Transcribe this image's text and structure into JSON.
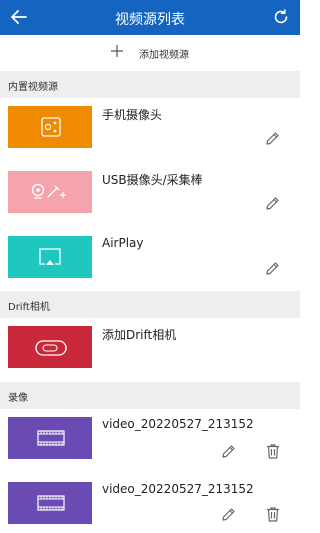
{
  "header": {
    "title": "视频源列表",
    "back_icon": "arrow-left-icon",
    "refresh_icon": "refresh-icon",
    "color": "#1565c0"
  },
  "add_source": {
    "label": "添加视频源",
    "icon": "plus-icon"
  },
  "sections": {
    "builtin": {
      "label": "内置视频源"
    },
    "drift": {
      "label": "Drift相机"
    },
    "recordings": {
      "label": "录像"
    }
  },
  "sources": [
    {
      "name": "手机摄像头",
      "color": "#f08a00",
      "icon": "phone-camera-icon"
    },
    {
      "name": "USB摄像头/采集棒",
      "color": "#f5a3ad",
      "icon": "usb-camera-icon"
    },
    {
      "name": "AirPlay",
      "color": "#1ec8bf",
      "icon": "airplay-icon"
    }
  ],
  "drift": [
    {
      "name": "添加Drift相机",
      "color": "#c8283a",
      "icon": "drift-camera-icon"
    }
  ],
  "recordings": [
    {
      "name": "video_20220527_213152",
      "color": "#6a4bb3",
      "icon": "film-icon"
    },
    {
      "name": "video_20220527_213152",
      "color": "#6a4bb3",
      "icon": "film-icon"
    }
  ]
}
